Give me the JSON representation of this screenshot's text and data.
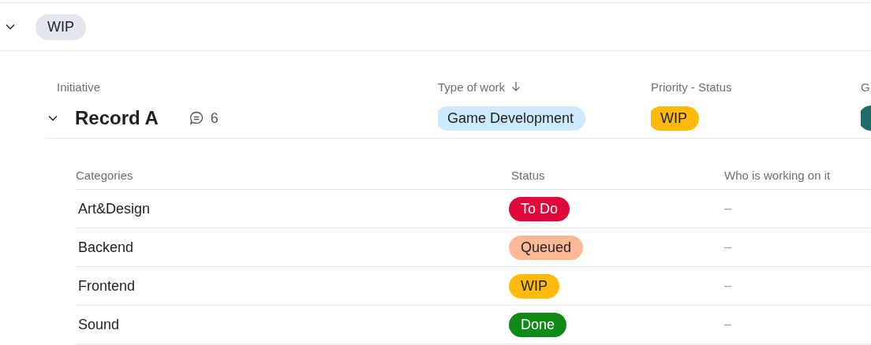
{
  "group": {
    "expanded": true,
    "label": "WIP"
  },
  "columns": [
    {
      "label": "Initiative",
      "sorted": false
    },
    {
      "label": "Type of work",
      "sorted": true
    },
    {
      "label": "Priority - Status",
      "sorted": false
    },
    {
      "label": "G",
      "sorted": false
    }
  ],
  "record": {
    "expanded": true,
    "name": "Record A",
    "comments": "6",
    "type": {
      "label": "Game Development",
      "color": "#cdeafd"
    },
    "priority": {
      "label": "WIP",
      "color": "#ffba0a"
    },
    "column_4": {
      "color": "#1b6e69"
    }
  },
  "subtable": {
    "columns": [
      "Categories",
      "Status",
      "Who is working on it"
    ],
    "rows": [
      {
        "category": "Art&Design",
        "status": {
          "label": "To Do",
          "color": "#e0073b"
        },
        "assignee": "–"
      },
      {
        "category": "Backend",
        "status": {
          "label": "Queued",
          "color": "#fdb996"
        },
        "assignee": "–"
      },
      {
        "category": "Frontend",
        "status": {
          "label": "WIP",
          "color": "#ffba0a"
        },
        "assignee": "–"
      },
      {
        "category": "Sound",
        "status": {
          "label": "Done",
          "color": "#0f8a17"
        },
        "assignee": "–"
      }
    ]
  }
}
